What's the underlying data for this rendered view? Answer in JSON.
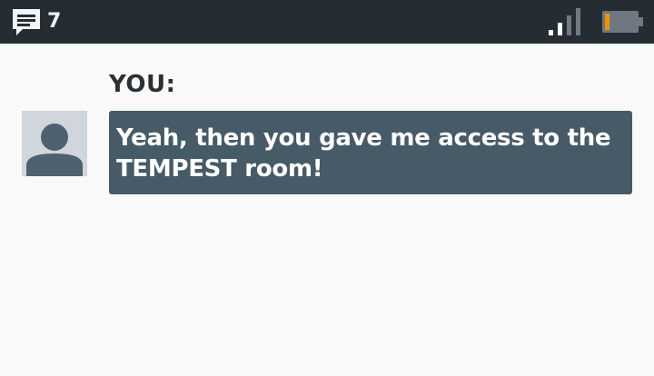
{
  "status_bar": {
    "message_icon": "message-icon",
    "message_count": "7",
    "signal_icon": "signal-icon",
    "signal_level": 0.5,
    "battery_icon": "battery-icon",
    "battery_level": 0.15,
    "battery_color": "#f39200",
    "background": "#252d33"
  },
  "dialogue": {
    "speaker": "YOU:",
    "avatar_icon": "person-avatar-icon",
    "text": "Yeah, then you gave me access to the TEMPEST room!",
    "bubble_color": "#475a67"
  }
}
